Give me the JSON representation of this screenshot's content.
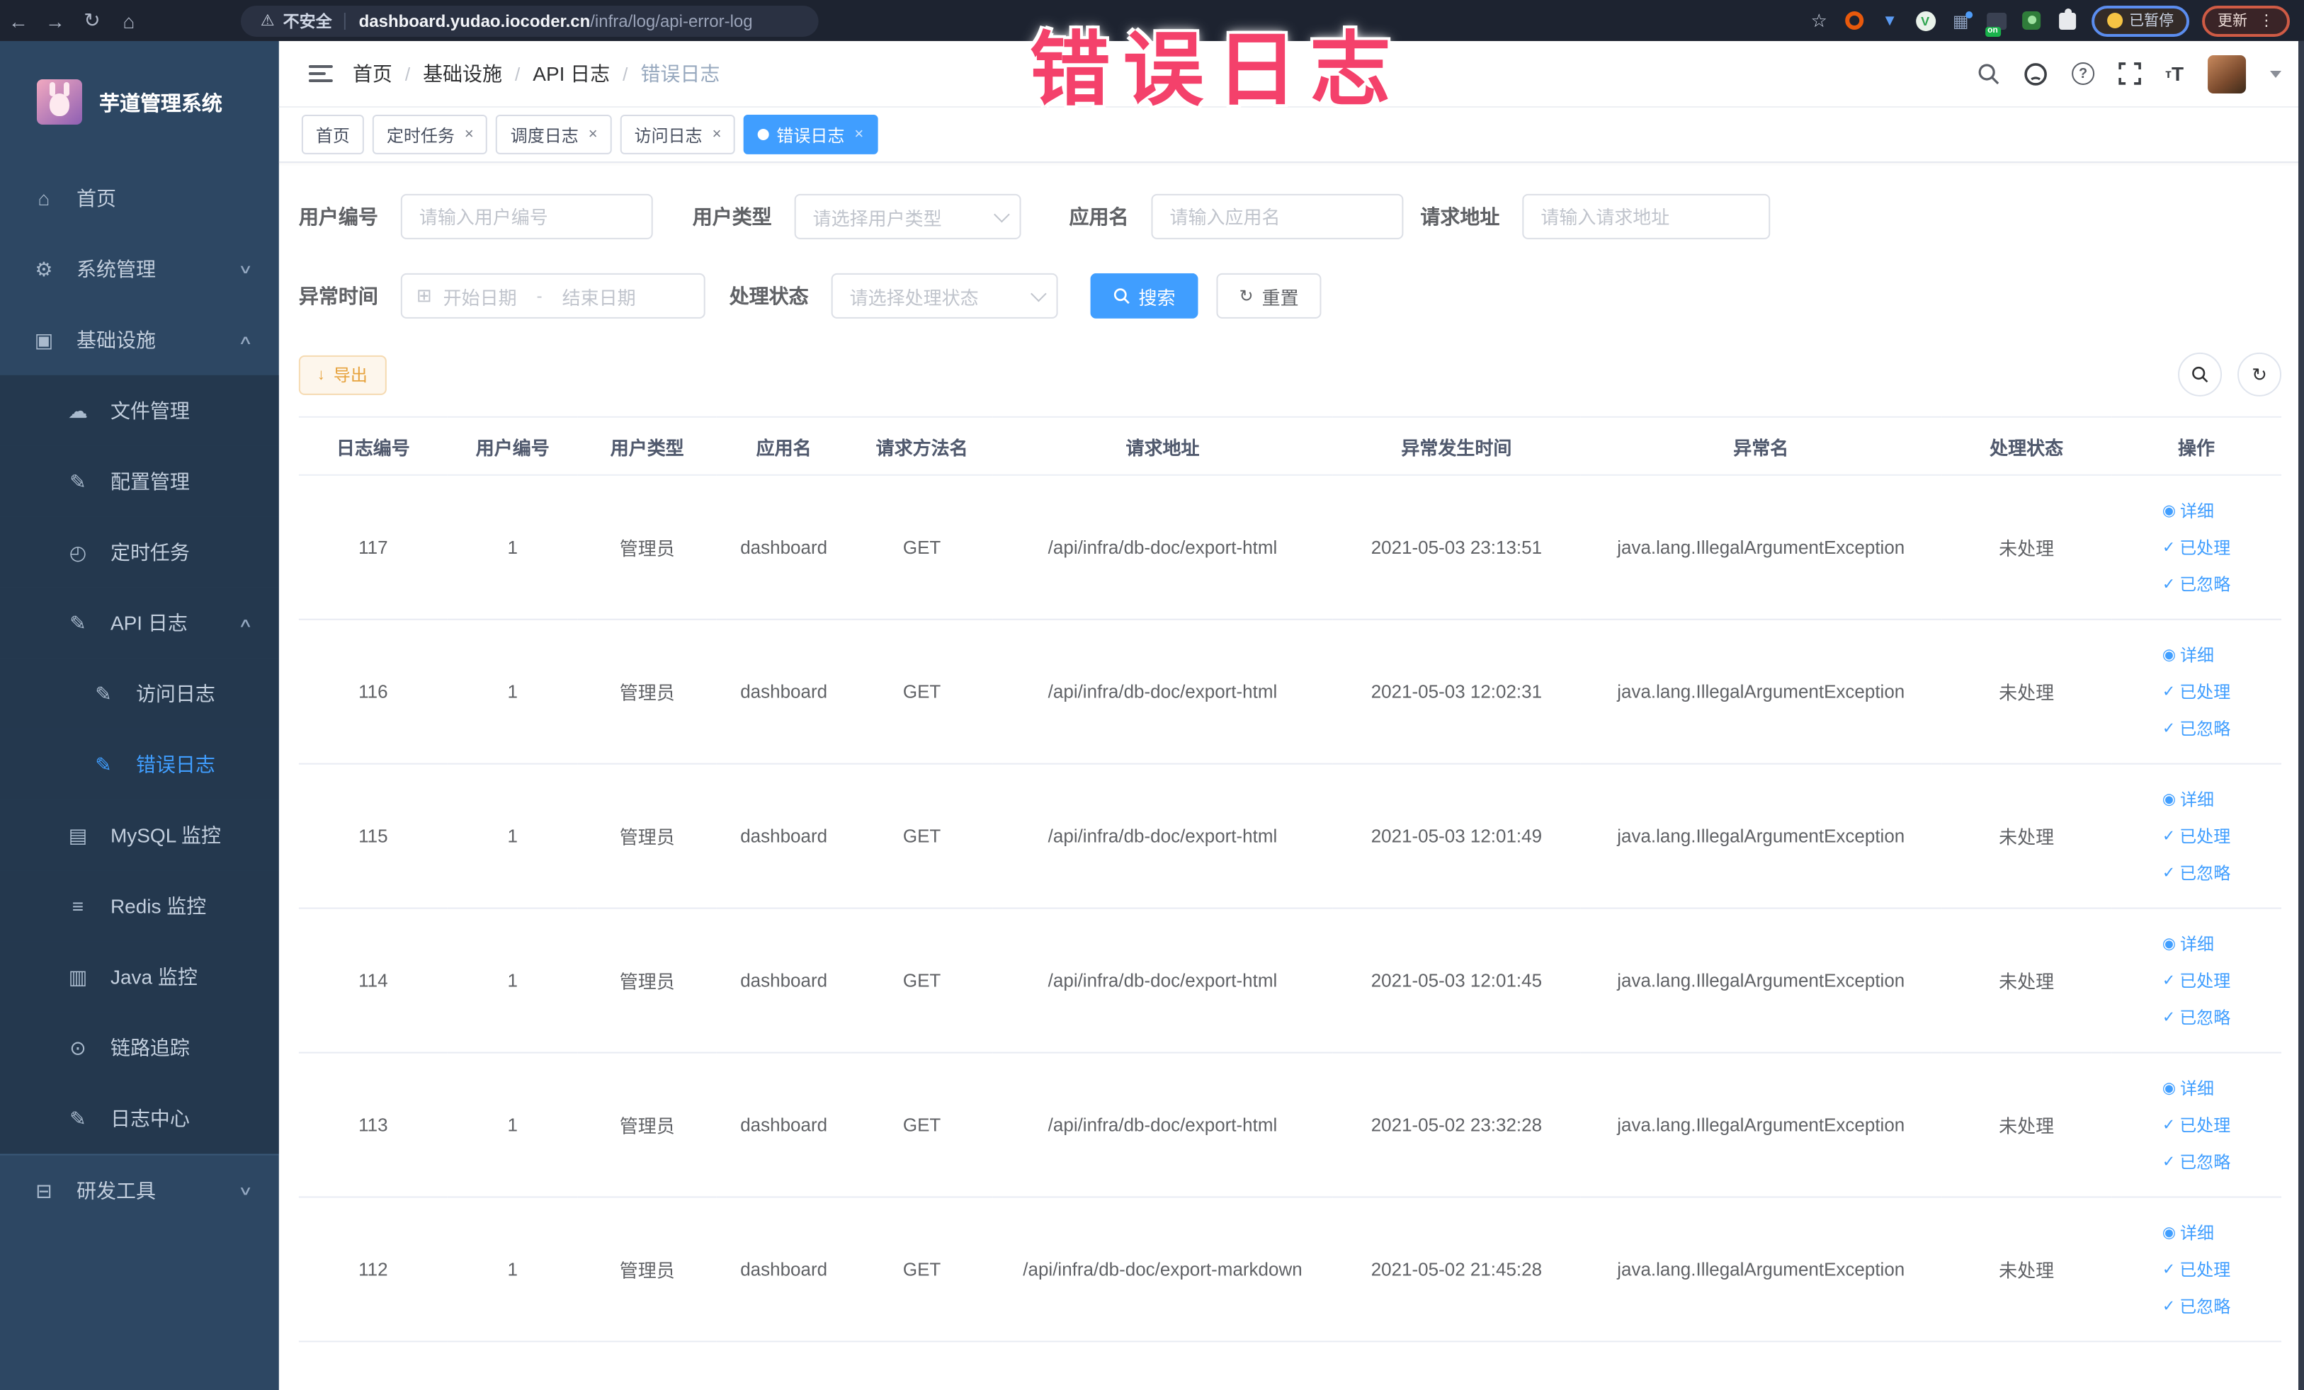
{
  "overlay_title": "错误日志",
  "browser": {
    "security_label": "不安全",
    "url_domain": "dashboard.yudao.iocoder.cn",
    "url_path": "/infra/log/api-error-log",
    "paused_badge": "已暂停",
    "update_label": "更新",
    "extension_on_badge": "on"
  },
  "sidebar": {
    "logo_text": "芋道管理系统",
    "items": [
      {
        "key": "home",
        "label": "首页",
        "icon": "home-icon",
        "level": 1,
        "arrow": null,
        "active": false,
        "in_group": false
      },
      {
        "key": "system",
        "label": "系统管理",
        "icon": "gear-icon",
        "level": 1,
        "arrow": "down",
        "active": false,
        "in_group": false
      },
      {
        "key": "infra",
        "label": "基础设施",
        "icon": "monitor-icon",
        "level": 1,
        "arrow": "up",
        "active": false,
        "in_group": false
      },
      {
        "key": "file",
        "label": "文件管理",
        "icon": "cloud-icon",
        "level": 2,
        "arrow": null,
        "active": false,
        "in_group": true
      },
      {
        "key": "config",
        "label": "配置管理",
        "icon": "edit-icon",
        "level": 2,
        "arrow": null,
        "active": false,
        "in_group": true
      },
      {
        "key": "job",
        "label": "定时任务",
        "icon": "timer-icon",
        "level": 2,
        "arrow": null,
        "active": false,
        "in_group": true
      },
      {
        "key": "api-log",
        "label": "API 日志",
        "icon": "document-edit-icon",
        "level": 2,
        "arrow": "up",
        "active": false,
        "in_group": true
      },
      {
        "key": "access-log",
        "label": "访问日志",
        "icon": "document-edit-icon",
        "level": 3,
        "arrow": null,
        "active": false,
        "in_group": true
      },
      {
        "key": "error-log",
        "label": "错误日志",
        "icon": "document-edit-icon",
        "level": 3,
        "arrow": null,
        "active": true,
        "in_group": true
      },
      {
        "key": "mysql",
        "label": "MySQL 监控",
        "icon": "mysql-monitor-icon",
        "level": 2,
        "arrow": null,
        "active": false,
        "in_group": true
      },
      {
        "key": "redis",
        "label": "Redis 监控",
        "icon": "redis-monitor-icon",
        "level": 2,
        "arrow": null,
        "active": false,
        "in_group": true
      },
      {
        "key": "java",
        "label": "Java 监控",
        "icon": "java-monitor-icon",
        "level": 2,
        "arrow": null,
        "active": false,
        "in_group": true
      },
      {
        "key": "trace",
        "label": "链路追踪",
        "icon": "trace-eye-icon",
        "level": 2,
        "arrow": null,
        "active": false,
        "in_group": true
      },
      {
        "key": "log-center",
        "label": "日志中心",
        "icon": "log-center-icon",
        "level": 2,
        "arrow": null,
        "active": false,
        "in_group": true
      },
      {
        "key": "dev-tools",
        "label": "研发工具",
        "icon": "toolbox-icon",
        "level": 1,
        "arrow": "down",
        "active": false,
        "in_group": false
      }
    ]
  },
  "header": {
    "breadcrumb": [
      "首页",
      "基础设施",
      "API 日志",
      "错误日志"
    ],
    "breadcrumb_separator": "/"
  },
  "tabs": [
    {
      "label": "首页",
      "closable": false,
      "active": false
    },
    {
      "label": "定时任务",
      "closable": true,
      "active": false
    },
    {
      "label": "调度日志",
      "closable": true,
      "active": false
    },
    {
      "label": "访问日志",
      "closable": true,
      "active": false
    },
    {
      "label": "错误日志",
      "closable": true,
      "active": true
    }
  ],
  "filters": {
    "user_id": {
      "label": "用户编号",
      "placeholder": "请输入用户编号"
    },
    "user_type": {
      "label": "用户类型",
      "placeholder": "请选择用户类型"
    },
    "app_name": {
      "label": "应用名",
      "placeholder": "请输入应用名"
    },
    "request_url": {
      "label": "请求地址",
      "placeholder": "请输入请求地址"
    },
    "exception_time": {
      "label": "异常时间",
      "start_placeholder": "开始日期",
      "end_placeholder": "结束日期",
      "separator": "-"
    },
    "process_status": {
      "label": "处理状态",
      "placeholder": "请选择处理状态"
    },
    "search_label": "搜索",
    "reset_label": "重置"
  },
  "toolbar": {
    "export_label": "导出"
  },
  "table": {
    "columns": [
      "日志编号",
      "用户编号",
      "用户类型",
      "应用名",
      "请求方法名",
      "请求地址",
      "异常发生时间",
      "异常名",
      "处理状态",
      "操作"
    ],
    "action_labels": [
      "详细",
      "已处理",
      "已忽略"
    ],
    "rows": [
      {
        "id": "117",
        "user_id": "1",
        "user_type": "管理员",
        "app": "dashboard",
        "method": "GET",
        "url": "/api/infra/db-doc/export-html",
        "time": "2021-05-03 23:13:51",
        "exception": "java.lang.IllegalArgumentException",
        "status": "未处理"
      },
      {
        "id": "116",
        "user_id": "1",
        "user_type": "管理员",
        "app": "dashboard",
        "method": "GET",
        "url": "/api/infra/db-doc/export-html",
        "time": "2021-05-03 12:02:31",
        "exception": "java.lang.IllegalArgumentException",
        "status": "未处理"
      },
      {
        "id": "115",
        "user_id": "1",
        "user_type": "管理员",
        "app": "dashboard",
        "method": "GET",
        "url": "/api/infra/db-doc/export-html",
        "time": "2021-05-03 12:01:49",
        "exception": "java.lang.IllegalArgumentException",
        "status": "未处理"
      },
      {
        "id": "114",
        "user_id": "1",
        "user_type": "管理员",
        "app": "dashboard",
        "method": "GET",
        "url": "/api/infra/db-doc/export-html",
        "time": "2021-05-03 12:01:45",
        "exception": "java.lang.IllegalArgumentException",
        "status": "未处理"
      },
      {
        "id": "113",
        "user_id": "1",
        "user_type": "管理员",
        "app": "dashboard",
        "method": "GET",
        "url": "/api/infra/db-doc/export-html",
        "time": "2021-05-02 23:32:28",
        "exception": "java.lang.IllegalArgumentException",
        "status": "未处理"
      },
      {
        "id": "112",
        "user_id": "1",
        "user_type": "管理员",
        "app": "dashboard",
        "method": "GET",
        "url": "/api/infra/db-doc/export-markdown",
        "time": "2021-05-02 21:45:28",
        "exception": "java.lang.IllegalArgumentException",
        "status": "未处理"
      }
    ]
  }
}
